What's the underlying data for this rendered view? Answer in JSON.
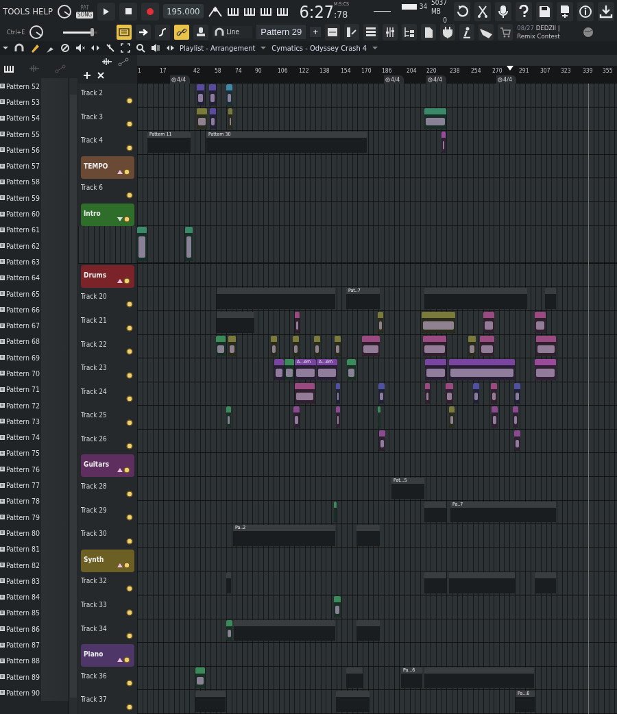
{
  "toolbar": {
    "menu": [
      "TOOLS",
      "HELP"
    ],
    "mode": [
      {
        "label": "PAT",
        "selected": false
      },
      {
        "label": "SONG",
        "selected": true
      }
    ],
    "tempo": "195.000",
    "time_main": "6:27",
    "time_cs": ":78",
    "time_format": "M:S:CS",
    "cpu": "34",
    "memory": "5037 MB",
    "polyphony": "0",
    "shortcut": "Ctrl+E",
    "volume": {
      "level": 0.85
    },
    "snap": "Line",
    "pattern": "Pattern 29",
    "add": "+",
    "toggles": [
      {
        "on": true
      },
      {
        "on": false
      },
      {
        "on": false
      },
      {
        "on": true
      },
      {
        "on": false
      }
    ],
    "news_date": "08/27",
    "news_text": "DEDZII | Remix Contest"
  },
  "playlist": {
    "title": "Playlist - Arrangement",
    "pattern": "Cymatics - Odyssey Crash 4"
  },
  "ruler": {
    "ticks": [
      "1",
      "17",
      "42",
      "58",
      "74",
      "90",
      "106",
      "122",
      "138",
      "154",
      "170",
      "186",
      "204",
      "220",
      "238",
      "254",
      "270",
      "291",
      "307",
      "323",
      "339",
      "355"
    ],
    "markers": [
      "4/4",
      "4/4",
      "4/4",
      "4/4"
    ]
  },
  "browser": {
    "items": [
      "Pattern 52",
      "Pattern 53",
      "Pattern 54",
      "Pattern 55",
      "Pattern 56",
      "Pattern 57",
      "Pattern 58",
      "Pattern 59",
      "Pattern 60",
      "Pattern 61",
      "Pattern 62",
      "Pattern 63",
      "Pattern 64",
      "Pattern 65",
      "Pattern 66",
      "Pattern 67",
      "Pattern 68",
      "Pattern 69",
      "Pattern 70",
      "Pattern 71",
      "Pattern 72",
      "Pattern 73",
      "Pattern 74",
      "Pattern 75",
      "Pattern 76",
      "Pattern 77",
      "Pattern 78",
      "Pattern 79",
      "Pattern 80",
      "Pattern 81",
      "Pattern 82",
      "Pattern 83",
      "Pattern 84",
      "Pattern 85",
      "Pattern 86",
      "Pattern 87",
      "Pattern 88",
      "Pattern 89",
      "Pattern 90"
    ]
  },
  "tracks": [
    {
      "kind": "track",
      "name": "Track 2",
      "clips": [
        {
          "color": "#5a4aa0"
        },
        {
          "color": "#5a4aa0"
        },
        {
          "color": "#3f8aa8"
        }
      ]
    },
    {
      "kind": "track",
      "name": "Track 3",
      "clips": [
        {
          "color": "#7a7a3a"
        },
        {
          "color": "#5a4aa0"
        },
        {
          "color": "#7a7a3a"
        },
        {
          "color": "#3a8a6a"
        }
      ]
    },
    {
      "kind": "track",
      "name": "Track 4",
      "clips": [
        {
          "label": "Pattern 11",
          "color": "#3a3d40"
        },
        {
          "label": "Pattern 30",
          "color": "#3a3d40"
        },
        {
          "color": "#9a4a9a"
        }
      ]
    },
    {
      "kind": "group",
      "name": "TEMPO",
      "color": "#6b4a35",
      "expanded": true
    },
    {
      "kind": "track",
      "name": "Track 6"
    },
    {
      "kind": "group",
      "name": "Intro",
      "color": "#2f6e2a",
      "expanded": false
    },
    {
      "kind": "lane",
      "clips": [
        {
          "color": "#3a8a6a"
        },
        {
          "color": "#3a8a6a"
        }
      ]
    },
    {
      "kind": "group",
      "name": "Drums",
      "color": "#7a2328",
      "expanded": true
    },
    {
      "kind": "track",
      "name": "Track 20",
      "clips": [
        {
          "color": "#3a3d40"
        },
        {
          "label": "Pat..7",
          "color": "#3a3d40"
        },
        {
          "color": "#3a3d40"
        },
        {
          "color": "#3a3d40"
        }
      ]
    },
    {
      "kind": "track",
      "name": "Track 21",
      "clips": [
        {
          "color": "#3a3d40"
        },
        {
          "color": "#9a4a80"
        },
        {
          "color": "#7a7a3a"
        },
        {
          "color": "#7a7a3a"
        },
        {
          "color": "#9a4a80"
        },
        {
          "color": "#9a4a80"
        }
      ]
    },
    {
      "kind": "track",
      "name": "Track 22",
      "clips": [
        {
          "color": "#3a8a5a"
        },
        {
          "color": "#7a7a3a"
        },
        {
          "color": "#7a7a3a"
        },
        {
          "color": "#7a7a3a"
        },
        {
          "color": "#7a7a3a"
        },
        {
          "color": "#7a7a3a"
        },
        {
          "color": "#9a4a80"
        },
        {
          "color": "#9a4a80"
        },
        {
          "color": "#7a7a3a"
        },
        {
          "color": "#9a4a80"
        },
        {
          "color": "#9a4a80"
        }
      ]
    },
    {
      "kind": "track",
      "name": "Track 23",
      "clips": [
        {
          "color": "#7a45a0"
        },
        {
          "color": "#3a8a5a"
        },
        {
          "label": "A...em",
          "color": "#7a45a0"
        },
        {
          "label": "A...em",
          "color": "#7a45a0"
        },
        {
          "color": "#3a8a5a"
        },
        {
          "color": "#7a45a0"
        },
        {
          "color": "#7a45a0"
        },
        {
          "color": "#9a4a9a"
        }
      ]
    },
    {
      "kind": "track",
      "name": "Track 24",
      "clips": [
        {
          "color": "#9a4a80"
        },
        {
          "color": "#5050a0"
        },
        {
          "color": "#5050a0"
        },
        {
          "color": "#9a4a80"
        },
        {
          "color": "#9a4a80"
        },
        {
          "color": "#5050a0"
        },
        {
          "color": "#9a4a80"
        },
        {
          "color": "#5050a0"
        }
      ]
    },
    {
      "kind": "track",
      "name": "Track 25",
      "clips": [
        {
          "color": "#3a8a5a"
        },
        {
          "color": "#8a4a90"
        },
        {
          "color": "#8a4a90"
        },
        {
          "color": "#3a8a5a"
        },
        {
          "color": "#7a7a3a"
        },
        {
          "color": "#8a4a90"
        },
        {
          "color": "#8a4a90"
        }
      ]
    },
    {
      "kind": "track",
      "name": "Track 26",
      "clips": [
        {
          "color": "#8a4a90"
        },
        {
          "color": "#8a4a90"
        }
      ]
    },
    {
      "kind": "group",
      "name": "Guitars",
      "color": "#5e2f5e",
      "expanded": true
    },
    {
      "kind": "track",
      "name": "Track 28",
      "clips": [
        {
          "label": "Pat...5",
          "color": "#3a3d40"
        }
      ]
    },
    {
      "kind": "track",
      "name": "Track 29",
      "clips": [
        {
          "color": "#3a8a5a"
        },
        {
          "color": "#3a3d40"
        },
        {
          "label": "Pa..7",
          "color": "#3a3d40"
        }
      ]
    },
    {
      "kind": "track",
      "name": "Track 30",
      "clips": [
        {
          "label": "Pa..2",
          "color": "#3a3d40"
        },
        {
          "color": "#3a3d40"
        }
      ]
    },
    {
      "kind": "group",
      "name": "Synth",
      "color": "#6b5f24",
      "expanded": true
    },
    {
      "kind": "track",
      "name": "Track 32",
      "clips": [
        {
          "color": "#3a3d40"
        },
        {
          "color": "#3a3d40"
        },
        {
          "color": "#3a3d40"
        },
        {
          "color": "#3a3d40"
        }
      ]
    },
    {
      "kind": "track",
      "name": "Track 33",
      "clips": [
        {
          "color": "#3a8a5a"
        }
      ]
    },
    {
      "kind": "track",
      "name": "Track 34",
      "clips": [
        {
          "color": "#3a8a5a"
        },
        {
          "color": "#3a3d40"
        },
        {
          "color": "#3a3d40"
        }
      ]
    },
    {
      "kind": "group",
      "name": "Piano",
      "color": "#4e3768",
      "expanded": true
    },
    {
      "kind": "track",
      "name": "Track 36",
      "clips": [
        {
          "color": "#3a8a5a"
        },
        {
          "color": "#3a3d40"
        },
        {
          "label": "Pa...6",
          "color": "#3a3d40"
        },
        {
          "color": "#3a3d40"
        }
      ]
    },
    {
      "kind": "track",
      "name": "Track 37",
      "clips": [
        {
          "color": "#3a3d40"
        },
        {
          "color": "#3a3d40"
        },
        {
          "label": "Pa...6",
          "color": "#3a3d40"
        }
      ]
    }
  ]
}
